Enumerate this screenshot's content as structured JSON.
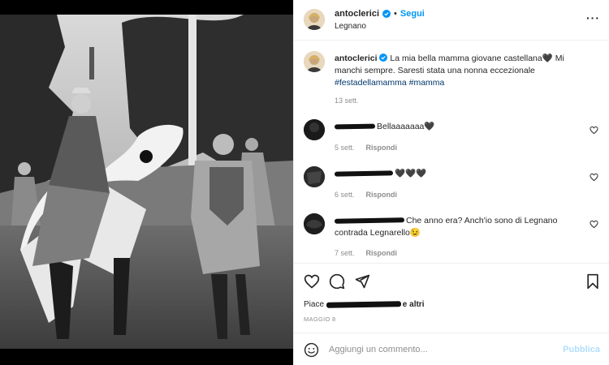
{
  "header": {
    "username": "antoclerici",
    "separator": "•",
    "follow_label": "Segui",
    "location": "Legnano",
    "more_label": "···"
  },
  "caption": {
    "username": "antoclerici",
    "text": "La mia bella mamma giovane castellana🖤 Mi manchi sempre. Saresti stata una nonna eccezionale",
    "hashtags": "#festadellamamma #mamma",
    "time": "13 sett."
  },
  "comments": [
    {
      "text": "Bellaaaaaaa🖤",
      "time": "5 sett.",
      "reply_label": "Rispondi"
    },
    {
      "text": "🖤🖤🖤",
      "time": "6 sett.",
      "reply_label": "Rispondi"
    },
    {
      "text": "Che anno era? Anch'io sono di Legnano contrada Legnarello😉",
      "time": "7 sett.",
      "reply_label": "Rispondi"
    }
  ],
  "likes": {
    "prefix": "Piace ",
    "suffix": "e altri"
  },
  "post_date": "MAGGIO 8",
  "comment_box": {
    "placeholder": "Aggiungi un commento...",
    "publish_label": "Pubblica"
  },
  "colors": {
    "accent": "#0095f6",
    "hashtag": "#00376b",
    "muted": "#8e8e8e",
    "publish_disabled": "#b2dffc"
  },
  "icons": [
    "verified-badge-icon",
    "more-options-icon",
    "heart-icon",
    "comment-icon",
    "share-icon",
    "bookmark-icon",
    "emoji-icon"
  ]
}
